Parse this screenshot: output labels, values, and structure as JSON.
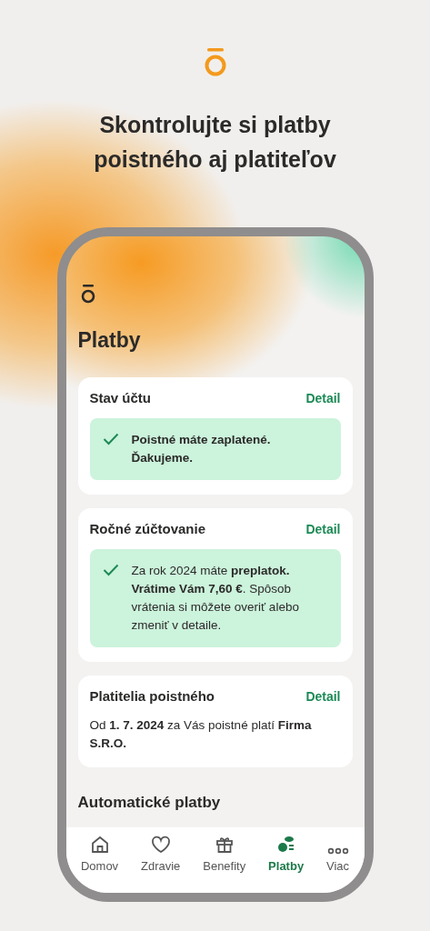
{
  "headline": "Skontrolujte si platby poistného aj platiteľov",
  "screen": {
    "title": "Platby",
    "cards": [
      {
        "title": "Stav účtu",
        "link": "Detail",
        "kind": "status",
        "body": "Poistné máte zaplatené. Ďakujeme."
      },
      {
        "title": "Ročné zúčtovanie",
        "link": "Detail",
        "kind": "status",
        "body": "Za rok 2024 máte **preplatok. Vrátime Vám 7,60 €**. Spôsob vrátenia si môžete overiť alebo zmeniť v detaile."
      },
      {
        "title": "Platitelia poistného",
        "link": "Detail",
        "kind": "text",
        "body": "Od **1. 7. 2024** za Vás poistné platí **Firma S.R.O.**"
      }
    ],
    "section_heading": "Automatické platby"
  },
  "nav": [
    {
      "label": "Domov",
      "selected": false
    },
    {
      "label": "Zdravie",
      "selected": false
    },
    {
      "label": "Benefity",
      "selected": false
    },
    {
      "label": "Platby",
      "selected": true
    },
    {
      "label": "Viac",
      "selected": false
    }
  ]
}
